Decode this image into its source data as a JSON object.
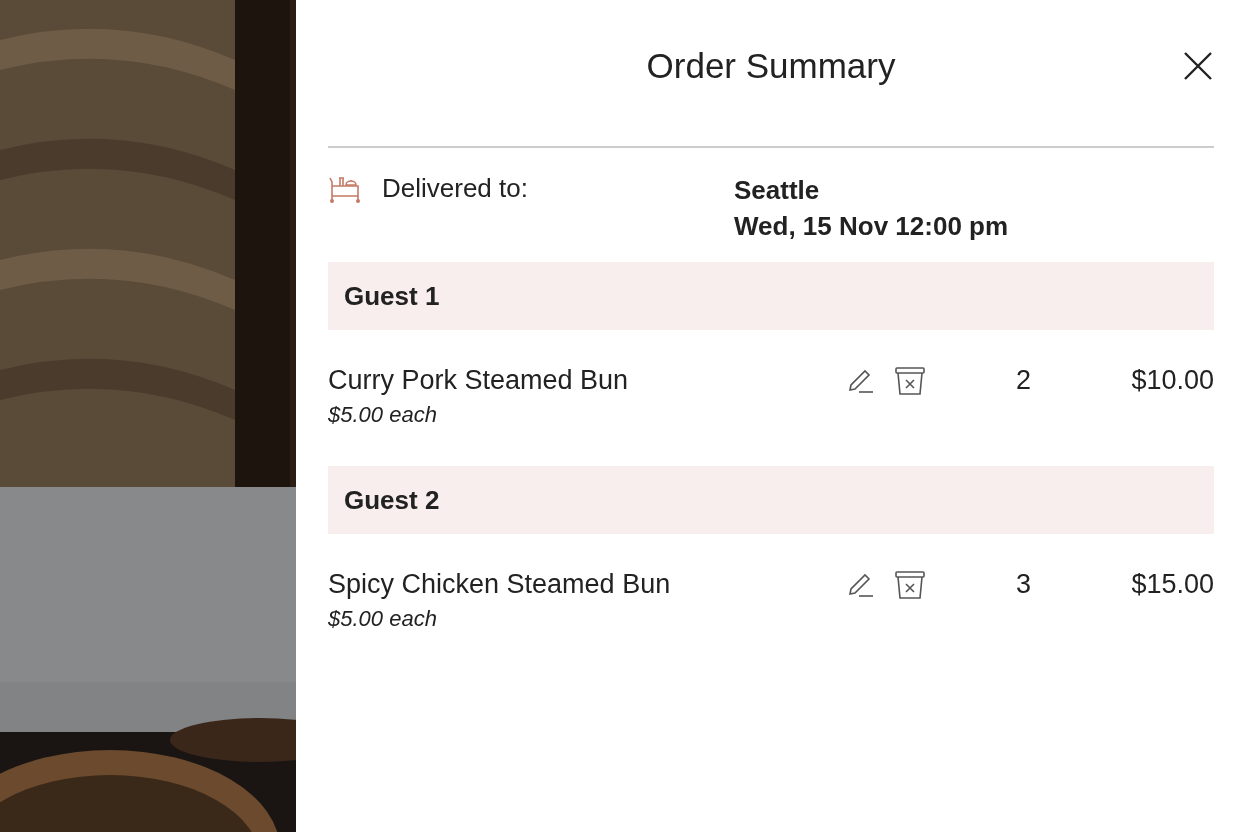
{
  "panel": {
    "title": "Order Summary",
    "delivery": {
      "label": "Delivered to:",
      "location": "Seattle",
      "time": "Wed, 15 Nov 12:00 pm"
    },
    "guests": [
      {
        "name": "Guest 1",
        "items": [
          {
            "name": "Curry Pork Steamed Bun",
            "unit_price": "$5.00 each",
            "quantity": "2",
            "total": "$10.00"
          }
        ]
      },
      {
        "name": "Guest 2",
        "items": [
          {
            "name": "Spicy Chicken Steamed Bun",
            "unit_price": "$5.00 each",
            "quantity": "3",
            "total": "$15.00"
          }
        ]
      }
    ]
  }
}
